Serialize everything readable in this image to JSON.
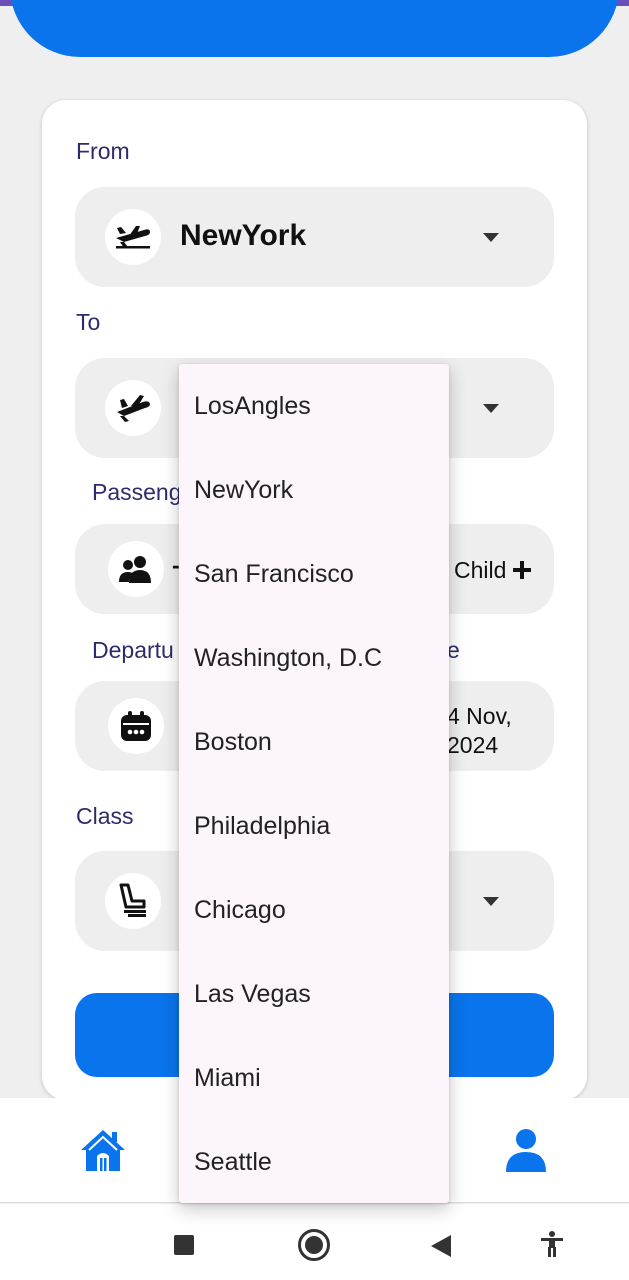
{
  "form": {
    "from_label": "From",
    "from_value": "NewYork",
    "to_label": "To",
    "passengers_label": "Passeng",
    "child_label": "Child",
    "departure_label": "Departu",
    "return_label_fragment": "e",
    "date_line1": "4 Nov,",
    "date_line2": "2024",
    "class_label": "Class"
  },
  "dropdown": {
    "options": [
      "LosAngles",
      "NewYork",
      "San Francisco",
      "Washington, D.C",
      "Boston",
      "Philadelphia",
      "Chicago",
      "Las Vegas",
      "Miami",
      "Seattle"
    ]
  },
  "icons": {
    "from": "airplane-takeoff-icon",
    "to": "airplane-landing-icon",
    "passengers": "people-icon",
    "date": "calendar-icon",
    "class": "seat-icon",
    "home": "home-icon",
    "profile": "person-icon"
  },
  "colors": {
    "primary": "#0a74ec",
    "label": "#2c2c6c",
    "menu_bg": "#fcf5fc",
    "status_bar": "#6a4fb8"
  }
}
